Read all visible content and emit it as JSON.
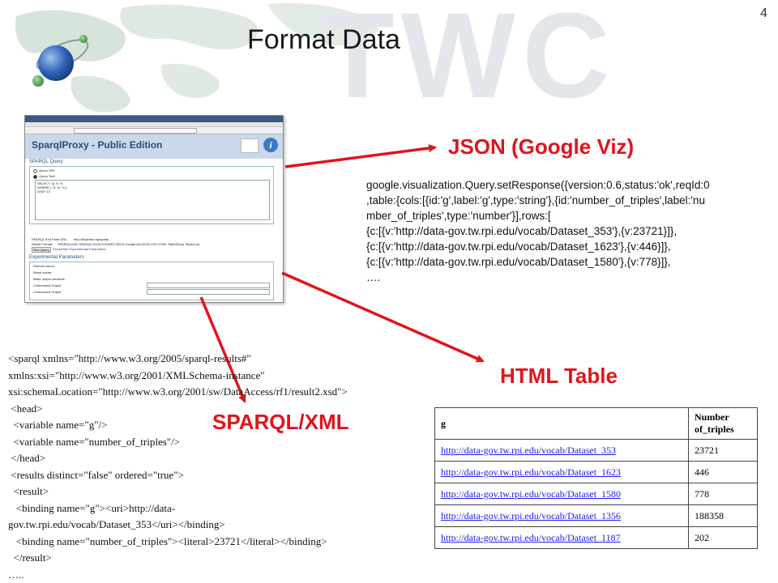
{
  "slide": {
    "number": "4",
    "title": "Format Data",
    "watermark": "TWC"
  },
  "screenshot": {
    "app_title": "SparqlProxy - Public Edition",
    "section_query": "SPARQL Query",
    "query_uri_label": "Query URI:",
    "query_text_label": "Query Text:",
    "query_lines": [
      "SELECT ?g ?x ?z",
      "WHERE { ?s ?p ?o }",
      "LIMIT 10"
    ],
    "endpoint_label": "SPARQL End Point URL:",
    "endpoint_value": "http://dbpedia.org/sparql",
    "result_format_label": "Result Format:",
    "result_formats": "SPARQL/XML  SPARQL/JSON  EXHIBIT/JSON  GoogleViz/JSON  CSV  HTML  Table(Row)  Table(Col)",
    "run_query": "Run Query",
    "show_params": "Show/Hide Experimental Parameters",
    "section_experimental": "Experimental Parameters",
    "params": [
      "Refresh cache:",
      "Reset cache:",
      "Make output viewable:",
      "Customized Output",
      "Customized Output"
    ]
  },
  "labels": {
    "json": "JSON (Google Viz)",
    "html_table": "HTML Table",
    "sparql_xml": "SPARQL/XML"
  },
  "json_text": "google.visualization.Query.setResponse({version:0.6,status:'ok',reqId:0\n,table:{cols:[{id:'g',label:'g',type:'string'},{id:'number_of_triples',label:'nu\nmber_of_triples',type:'number'}],rows:[\n{c:[{v:'http://data-gov.tw.rpi.edu/vocab/Dataset_353'},{v:23721}]},\n{c:[{v:'http://data-gov.tw.rpi.edu/vocab/Dataset_1623'},{v:446}]},\n{c:[{v:'http://data-gov.tw.rpi.edu/vocab/Dataset_1580'},{v:778}]},\n….",
  "xml_text": "<sparql xmlns=\"http://www.w3.org/2005/sparql-results#\"\nxmlns:xsi=\"http://www.w3.org/2001/XMLSchema-instance\"\nxsi:schemaLocation=\"http://www.w3.org/2001/sw/DataAccess/rf1/result2.xsd\">\n <head>\n  <variable name=\"g\"/>\n  <variable name=\"number_of_triples\"/>\n </head>\n <results distinct=\"false\" ordered=\"true\">\n  <result>\n   <binding name=\"g\"><uri>http://data-\ngov.tw.rpi.edu/vocab/Dataset_353</uri></binding>\n   <binding name=\"number_of_triples\"><literal>23721</literal></binding>\n  </result>\n…..",
  "table": {
    "headers": [
      "g",
      "Number of_triples"
    ],
    "rows": [
      [
        "http://data-gov.tw.rpi.edu/vocab/Dataset_353",
        "23721"
      ],
      [
        "http://data-gov.tw.rpi.edu/vocab/Dataset_1623",
        "446"
      ],
      [
        "http://data-gov.tw.rpi.edu/vocab/Dataset_1580",
        "778"
      ],
      [
        "http://data-gov.tw.rpi.edu/vocab/Dataset_1356",
        "188358"
      ],
      [
        "http://data-gov.tw.rpi.edu/vocab/Dataset_1187",
        "202"
      ]
    ]
  },
  "colors": {
    "label_red": "#e0141b",
    "link_blue": "#1a1aee",
    "map_green": "#4f8a5b",
    "globe_blue": "#2f63b8"
  }
}
